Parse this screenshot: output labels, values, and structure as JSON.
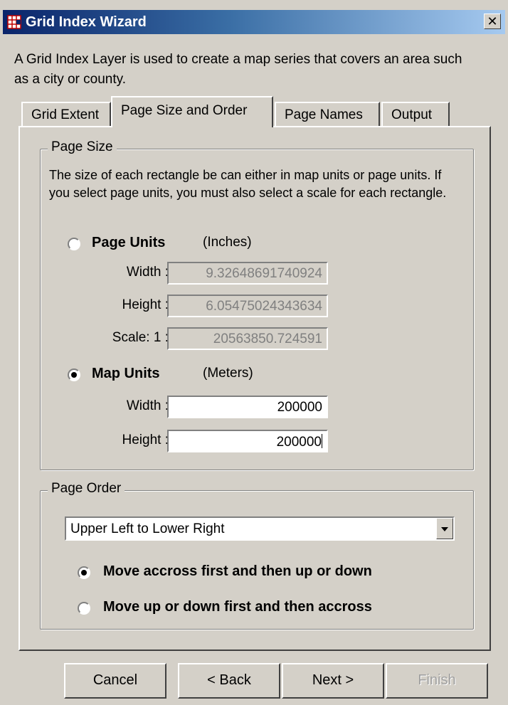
{
  "window": {
    "title": "Grid Index Wizard",
    "close_glyph": "✕"
  },
  "intro": "A Grid Index Layer is used to create a map series that covers an area such as a city or county.",
  "tabs": [
    {
      "label": "Grid Extent",
      "active": false
    },
    {
      "label": "Page Size and Order",
      "active": true
    },
    {
      "label": "Page Names",
      "active": false
    },
    {
      "label": "Output",
      "active": false
    }
  ],
  "page_size": {
    "legend": "Page Size",
    "description": "The size of each rectangle be can either in map units or page units.  If you select page units, you must also select a scale for each rectangle.",
    "page_units": {
      "label": "Page Units",
      "unit": "(Inches)",
      "selected": false,
      "width_label": "Width :",
      "width_value": "9.32648691740924",
      "height_label": "Height :",
      "height_value": "6.05475024343634",
      "scale_label": "Scale:  1 :",
      "scale_value": "20563850.724591"
    },
    "map_units": {
      "label": "Map Units",
      "unit": "(Meters)",
      "selected": true,
      "width_label": "Width :",
      "width_value": "200000",
      "height_label": "Height :",
      "height_value": "200000"
    }
  },
  "page_order": {
    "legend": "Page Order",
    "selected": "Upper Left to Lower Right",
    "options": [
      {
        "label": "Move accross first and then up or down",
        "selected": true
      },
      {
        "label": "Move up or down first and then accross",
        "selected": false
      }
    ]
  },
  "buttons": {
    "cancel": "Cancel",
    "back": "< Back",
    "next": "Next >",
    "finish": "Finish"
  },
  "colors": {
    "face": "#d4d0c8",
    "title_start": "#0a246a",
    "title_end": "#a6caf0"
  }
}
